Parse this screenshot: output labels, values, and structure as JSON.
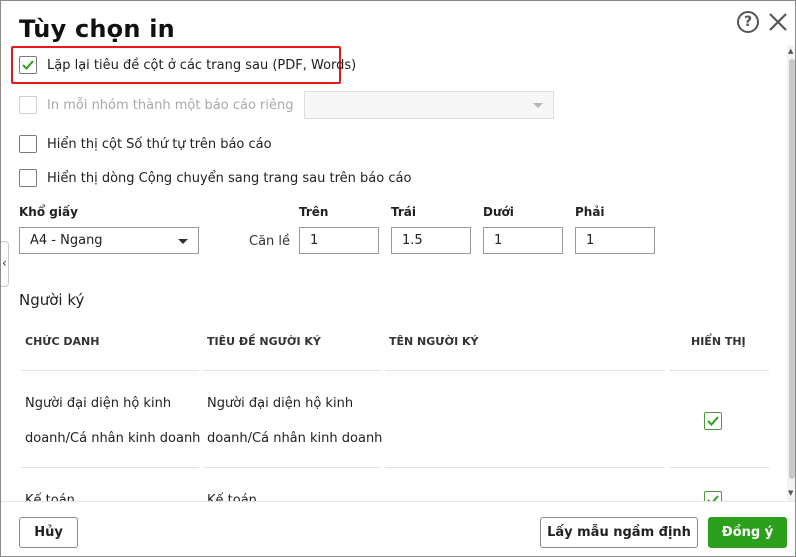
{
  "dialog": {
    "title": "Tùy chọn in",
    "help_label": "?"
  },
  "options": {
    "repeat_header": {
      "label": "Lặp lại tiêu đề cột ở các trang sau (PDF, Words)",
      "checked": true
    },
    "print_group": {
      "label": "In mỗi nhóm thành một báo cáo riêng",
      "checked": false,
      "disabled": true,
      "select_value": ""
    },
    "show_index_col": {
      "label": "Hiển thị cột Số thứ tự trên báo cáo",
      "checked": false
    },
    "show_carry_row": {
      "label": "Hiển thị dòng Cộng chuyển sang trang sau trên báo cáo",
      "checked": false
    }
  },
  "paper": {
    "label": "Khổ giấy",
    "value": "A4 - Ngang"
  },
  "margins": {
    "label": "Căn lề",
    "top_label": "Trên",
    "top_value": "1",
    "left_label": "Trái",
    "left_value": "1.5",
    "bottom_label": "Dưới",
    "bottom_value": "1",
    "right_label": "Phải",
    "right_value": "1"
  },
  "signers": {
    "title": "Người ký",
    "columns": [
      "CHỨC DANH",
      "TIÊU ĐỀ NGƯỜI KÝ",
      "TÊN NGƯỜI KÝ",
      "HIỂN THỊ"
    ],
    "rows": [
      {
        "position_line1": "Người đại diện hộ kinh",
        "position_line2": "doanh/Cá nhân kinh doanh",
        "title_line1": "Người đại diện hộ kinh",
        "title_line2": "doanh/Cá nhân kinh doanh",
        "name": "",
        "show": true
      },
      {
        "position_line1": "Kế toán",
        "title_line1": "Kế toán",
        "name": "",
        "show": true
      }
    ]
  },
  "footer": {
    "cancel_label": "Hủy",
    "default_label": "Lấy mẫu ngầm định",
    "ok_label": "Đồng ý"
  },
  "colors": {
    "accent": "#2ca01c",
    "highlight": "#e21b1b"
  }
}
